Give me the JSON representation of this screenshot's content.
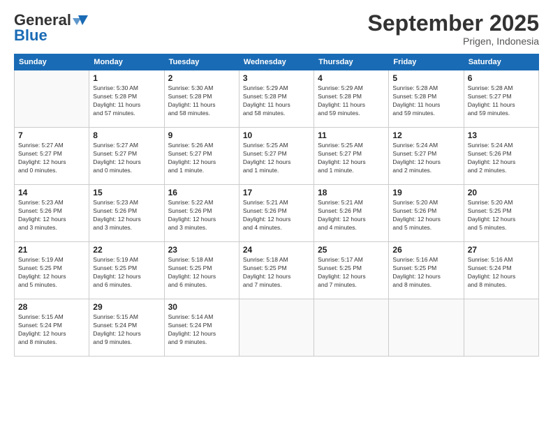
{
  "logo": {
    "line1": "General",
    "line2": "Blue"
  },
  "title": "September 2025",
  "location": "Prigen, Indonesia",
  "days_of_week": [
    "Sunday",
    "Monday",
    "Tuesday",
    "Wednesday",
    "Thursday",
    "Friday",
    "Saturday"
  ],
  "weeks": [
    [
      {
        "day": "",
        "info": ""
      },
      {
        "day": "1",
        "info": "Sunrise: 5:30 AM\nSunset: 5:28 PM\nDaylight: 11 hours\nand 57 minutes."
      },
      {
        "day": "2",
        "info": "Sunrise: 5:30 AM\nSunset: 5:28 PM\nDaylight: 11 hours\nand 58 minutes."
      },
      {
        "day": "3",
        "info": "Sunrise: 5:29 AM\nSunset: 5:28 PM\nDaylight: 11 hours\nand 58 minutes."
      },
      {
        "day": "4",
        "info": "Sunrise: 5:29 AM\nSunset: 5:28 PM\nDaylight: 11 hours\nand 59 minutes."
      },
      {
        "day": "5",
        "info": "Sunrise: 5:28 AM\nSunset: 5:28 PM\nDaylight: 11 hours\nand 59 minutes."
      },
      {
        "day": "6",
        "info": "Sunrise: 5:28 AM\nSunset: 5:27 PM\nDaylight: 11 hours\nand 59 minutes."
      }
    ],
    [
      {
        "day": "7",
        "info": "Sunrise: 5:27 AM\nSunset: 5:27 PM\nDaylight: 12 hours\nand 0 minutes."
      },
      {
        "day": "8",
        "info": "Sunrise: 5:27 AM\nSunset: 5:27 PM\nDaylight: 12 hours\nand 0 minutes."
      },
      {
        "day": "9",
        "info": "Sunrise: 5:26 AM\nSunset: 5:27 PM\nDaylight: 12 hours\nand 1 minute."
      },
      {
        "day": "10",
        "info": "Sunrise: 5:25 AM\nSunset: 5:27 PM\nDaylight: 12 hours\nand 1 minute."
      },
      {
        "day": "11",
        "info": "Sunrise: 5:25 AM\nSunset: 5:27 PM\nDaylight: 12 hours\nand 1 minute."
      },
      {
        "day": "12",
        "info": "Sunrise: 5:24 AM\nSunset: 5:27 PM\nDaylight: 12 hours\nand 2 minutes."
      },
      {
        "day": "13",
        "info": "Sunrise: 5:24 AM\nSunset: 5:26 PM\nDaylight: 12 hours\nand 2 minutes."
      }
    ],
    [
      {
        "day": "14",
        "info": "Sunrise: 5:23 AM\nSunset: 5:26 PM\nDaylight: 12 hours\nand 3 minutes."
      },
      {
        "day": "15",
        "info": "Sunrise: 5:23 AM\nSunset: 5:26 PM\nDaylight: 12 hours\nand 3 minutes."
      },
      {
        "day": "16",
        "info": "Sunrise: 5:22 AM\nSunset: 5:26 PM\nDaylight: 12 hours\nand 3 minutes."
      },
      {
        "day": "17",
        "info": "Sunrise: 5:21 AM\nSunset: 5:26 PM\nDaylight: 12 hours\nand 4 minutes."
      },
      {
        "day": "18",
        "info": "Sunrise: 5:21 AM\nSunset: 5:26 PM\nDaylight: 12 hours\nand 4 minutes."
      },
      {
        "day": "19",
        "info": "Sunrise: 5:20 AM\nSunset: 5:26 PM\nDaylight: 12 hours\nand 5 minutes."
      },
      {
        "day": "20",
        "info": "Sunrise: 5:20 AM\nSunset: 5:25 PM\nDaylight: 12 hours\nand 5 minutes."
      }
    ],
    [
      {
        "day": "21",
        "info": "Sunrise: 5:19 AM\nSunset: 5:25 PM\nDaylight: 12 hours\nand 5 minutes."
      },
      {
        "day": "22",
        "info": "Sunrise: 5:19 AM\nSunset: 5:25 PM\nDaylight: 12 hours\nand 6 minutes."
      },
      {
        "day": "23",
        "info": "Sunrise: 5:18 AM\nSunset: 5:25 PM\nDaylight: 12 hours\nand 6 minutes."
      },
      {
        "day": "24",
        "info": "Sunrise: 5:18 AM\nSunset: 5:25 PM\nDaylight: 12 hours\nand 7 minutes."
      },
      {
        "day": "25",
        "info": "Sunrise: 5:17 AM\nSunset: 5:25 PM\nDaylight: 12 hours\nand 7 minutes."
      },
      {
        "day": "26",
        "info": "Sunrise: 5:16 AM\nSunset: 5:25 PM\nDaylight: 12 hours\nand 8 minutes."
      },
      {
        "day": "27",
        "info": "Sunrise: 5:16 AM\nSunset: 5:24 PM\nDaylight: 12 hours\nand 8 minutes."
      }
    ],
    [
      {
        "day": "28",
        "info": "Sunrise: 5:15 AM\nSunset: 5:24 PM\nDaylight: 12 hours\nand 8 minutes."
      },
      {
        "day": "29",
        "info": "Sunrise: 5:15 AM\nSunset: 5:24 PM\nDaylight: 12 hours\nand 9 minutes."
      },
      {
        "day": "30",
        "info": "Sunrise: 5:14 AM\nSunset: 5:24 PM\nDaylight: 12 hours\nand 9 minutes."
      },
      {
        "day": "",
        "info": ""
      },
      {
        "day": "",
        "info": ""
      },
      {
        "day": "",
        "info": ""
      },
      {
        "day": "",
        "info": ""
      }
    ]
  ]
}
